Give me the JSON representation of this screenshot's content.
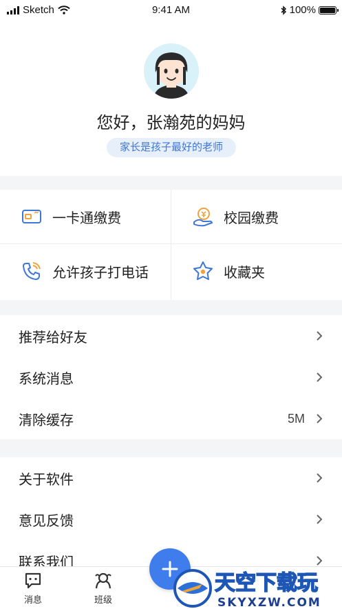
{
  "status_bar": {
    "carrier": "Sketch",
    "time": "9:41 AM",
    "battery": "100%"
  },
  "profile": {
    "greeting": "您好，张瀚苑的妈妈",
    "tagline": "家长是孩子最好的老师"
  },
  "quick_actions": [
    {
      "label": "一卡通缴费",
      "icon": "card-icon"
    },
    {
      "label": "校园缴费",
      "icon": "payment-icon"
    },
    {
      "label": "允许孩子打电话",
      "icon": "phone-icon"
    },
    {
      "label": "收藏夹",
      "icon": "star-icon"
    }
  ],
  "menu_group_1": [
    {
      "label": "推荐给好友",
      "value": ""
    },
    {
      "label": "系统消息",
      "value": ""
    },
    {
      "label": "清除缓存",
      "value": "5M"
    }
  ],
  "menu_group_2": [
    {
      "label": "关于软件",
      "value": ""
    },
    {
      "label": "意见反馈",
      "value": ""
    },
    {
      "label": "联系我们",
      "value": ""
    }
  ],
  "tabbar": {
    "messages": "消息",
    "class": "班级"
  },
  "watermark": {
    "title": "天空下载玩",
    "domain": "SKYXZW.COM"
  },
  "colors": {
    "accent": "#3f7ded",
    "icon_orange": "#f0a23b",
    "icon_blue": "#3e77d8"
  }
}
